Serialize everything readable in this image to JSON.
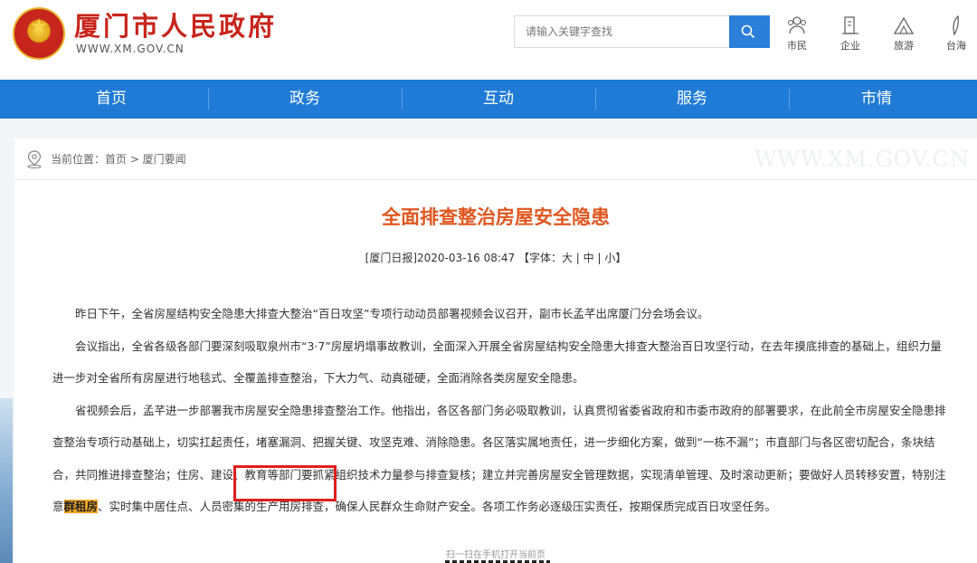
{
  "header": {
    "site_title": "厦门市人民政府",
    "site_domain": "WWW.XM.GOV.CN",
    "search_placeholder": "请输入关键字查找",
    "quick_links": [
      {
        "label": "市民",
        "icon": "citizen-icon"
      },
      {
        "label": "企业",
        "icon": "enterprise-icon"
      },
      {
        "label": "旅游",
        "icon": "tourism-icon"
      },
      {
        "label": "台海",
        "icon": "taihai-icon"
      }
    ]
  },
  "nav": [
    "首页",
    "政务",
    "互动",
    "服务",
    "市情"
  ],
  "breadcrumb": {
    "text": "当前位置：首页 > 厦门要闻",
    "watermark": "WWW.XM.GOV.CN"
  },
  "article": {
    "title": "全面排查整治房屋安全隐患",
    "meta": "[厦门日报]2020-03-16 08:47 【字体：大 | 中 | 小】",
    "p1": "昨日下午，全省房屋结构安全隐患大排查大整治“百日攻坚”专项行动动员部署视频会议召开，副市长孟芊出席厦门分会场会议。",
    "p2": "会议指出，全省各级各部门要深刻吸取泉州市“3·7”房屋坍塌事故教训，全面深入开展全省房屋结构安全隐患大排查大整治百日攻坚行动，在去年摸底排查的基础上，组织力量进一步对全省所有房屋进行地毯式、全覆盖排查整治，下大力气、动真碰硬，全面消除各类房屋安全隐患。",
    "p3_before": "省视频会后，孟芊进一步部署我市房屋安全隐患排查整治工作。他指出，各区各部门务必吸取教训，认真贯彻省委省政府和市委市政府的部署要求，在此前全市房屋安全隐患排查整治专项行动基础上，切实扛起责任，堵塞漏洞、把握关键、攻坚克难、消除隐患。各区落实属地责任，进一步细化方案，做到“一栋不漏”；市直部门与各区密切配合，条块结合，共同推进排查整治；住房、建设、教育等部门要抓紧组织技术力量参与排查复核；建立并完善房屋安全管理数据，实现清单管理、及时滚动更新；要做好人员转移安置，特别注意",
    "p3_highlight": "群租房",
    "p3_after": "、实时集中居住点、人员密集的生产用房排查，确保人民群众生命财产安全。各项工作务必逐级压实责任，按期保质完成百日攻坚任务。"
  },
  "qr_caption": "扫一扫在手机打开当前页",
  "colors": {
    "nav_blue": "#1f7bd6",
    "title_red": "#c8251c",
    "headline_orange": "#e0561f",
    "highlight": "#f5a623",
    "annotation_red": "#e21d1d"
  }
}
